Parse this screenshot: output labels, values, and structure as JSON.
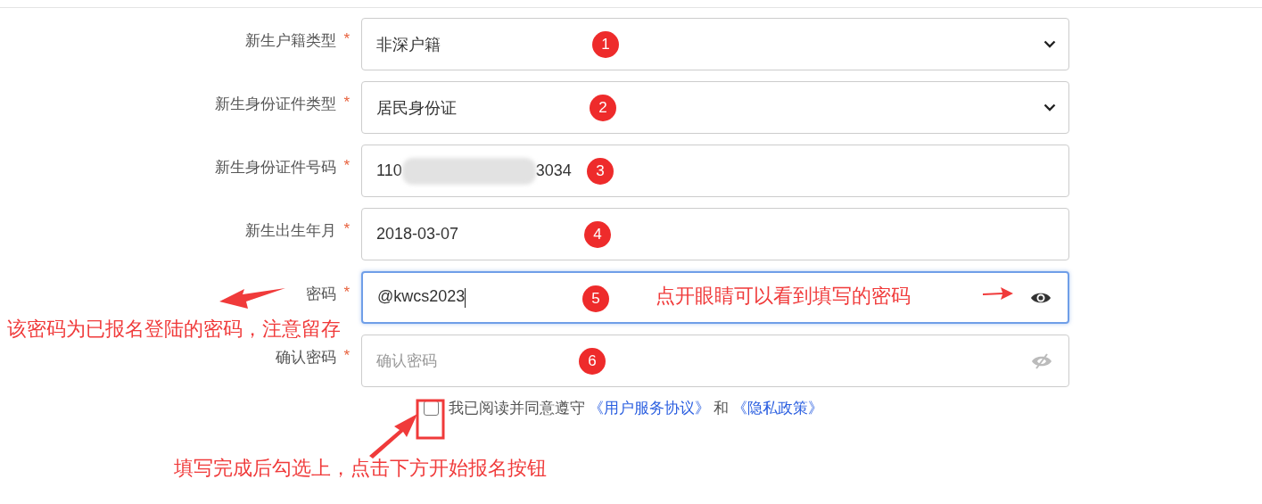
{
  "fields": [
    {
      "label": "新生户籍类型",
      "required_mark": "*",
      "kind": "select",
      "value": "非深户籍",
      "marker": "1"
    },
    {
      "label": "新生身份证件类型",
      "required_mark": "*",
      "kind": "select",
      "value": "居民身份证",
      "marker": "2"
    },
    {
      "label": "新生身份证件号码",
      "required_mark": "*",
      "kind": "masked",
      "visible_parts": [
        "110",
        "3034"
      ],
      "marker": "3"
    },
    {
      "label": "新生出生年月",
      "required_mark": "*",
      "kind": "text",
      "value": "2018-03-07",
      "marker": "4"
    },
    {
      "label": "密码",
      "required_mark": "*",
      "kind": "password",
      "value": "@kwcs2023",
      "focused": true,
      "password_visible": true,
      "marker": "5"
    },
    {
      "label": "确认密码",
      "required_mark": "*",
      "kind": "password",
      "placeholder": "确认密码",
      "focused": false,
      "password_visible": false,
      "marker": "6"
    }
  ],
  "agreement": {
    "checked": false,
    "text": "我已阅读并同意遵守",
    "link_1": "《用户服务协议》",
    "joiner": "和",
    "link_2": "《隐私政策》"
  },
  "annotations": [
    {
      "kind": "password_note",
      "text": "该密码为已报名登陆的密码，注意留存"
    },
    {
      "kind": "eye_note",
      "text": "点开眼睛可以看到填写的密码"
    },
    {
      "kind": "checkbox_note",
      "text": "填写完成后勾选上，点击下方开始报名按钮"
    }
  ]
}
